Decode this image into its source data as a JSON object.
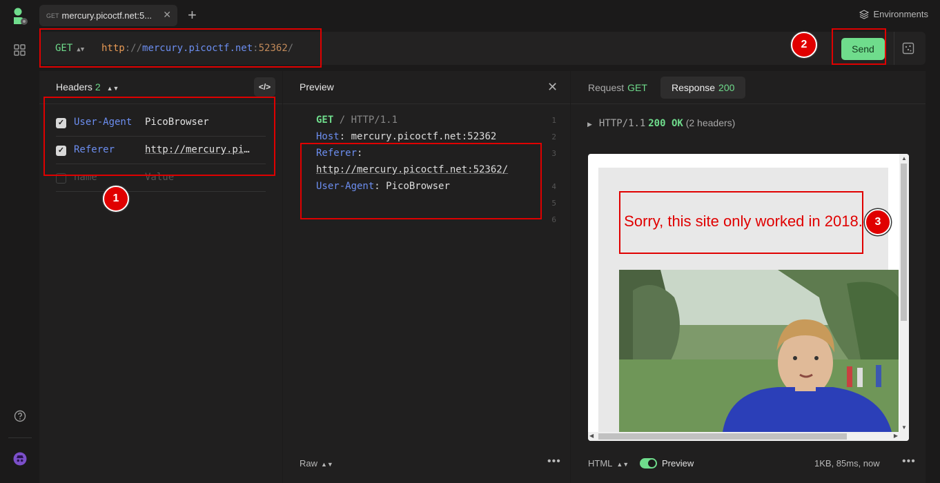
{
  "tab": {
    "method": "GET",
    "title": "mercury.picoctf.net:5..."
  },
  "environments_label": "Environments",
  "request": {
    "method": "GET",
    "url": {
      "scheme": "http",
      "sep": "://",
      "host": "mercury.picoctf.net",
      "colon": ":",
      "port": "52362",
      "path": "/"
    },
    "send_label": "Send"
  },
  "headers_panel": {
    "title": "Headers",
    "count": "2",
    "rows": [
      {
        "name": "User-Agent",
        "value": "PicoBrowser",
        "checked": true
      },
      {
        "name": "Referer",
        "value": "http://mercury.picoctf.net:52362/",
        "checked": true
      }
    ],
    "placeholder": {
      "name": "name",
      "value": "Value"
    }
  },
  "preview_panel": {
    "title": "Preview",
    "lines": {
      "request_method": "GET",
      "request_sep": " / ",
      "request_proto": "HTTP/1.1",
      "host_key": "Host",
      "host_val": "mercury.picoctf.net:52362",
      "ref_key": "Referer",
      "ref_val": "http://mercury.picoctf.net:52362/",
      "ua_key": "User-Agent",
      "ua_val": "PicoBrowser"
    },
    "line_numbers": [
      "1",
      "2",
      "3",
      "4",
      "5",
      "6"
    ],
    "footer_mode": "Raw"
  },
  "response_panel": {
    "tab_request": "Request",
    "tab_request_method": "GET",
    "tab_response": "Response",
    "tab_response_code": "200",
    "status_proto": "HTTP/1.1",
    "status_code": "200 OK",
    "status_headers": "(2 headers)",
    "page_message": "Sorry, this site only worked in 2018.",
    "footer_format": "HTML",
    "footer_preview": "Preview",
    "footer_meta": "1KB, 85ms, now"
  },
  "annotations": [
    "1",
    "2",
    "3"
  ],
  "colors": {
    "accent_green": "#6fdc8c",
    "annotation_red": "#e00000",
    "header_blue": "#6c8ef0"
  }
}
